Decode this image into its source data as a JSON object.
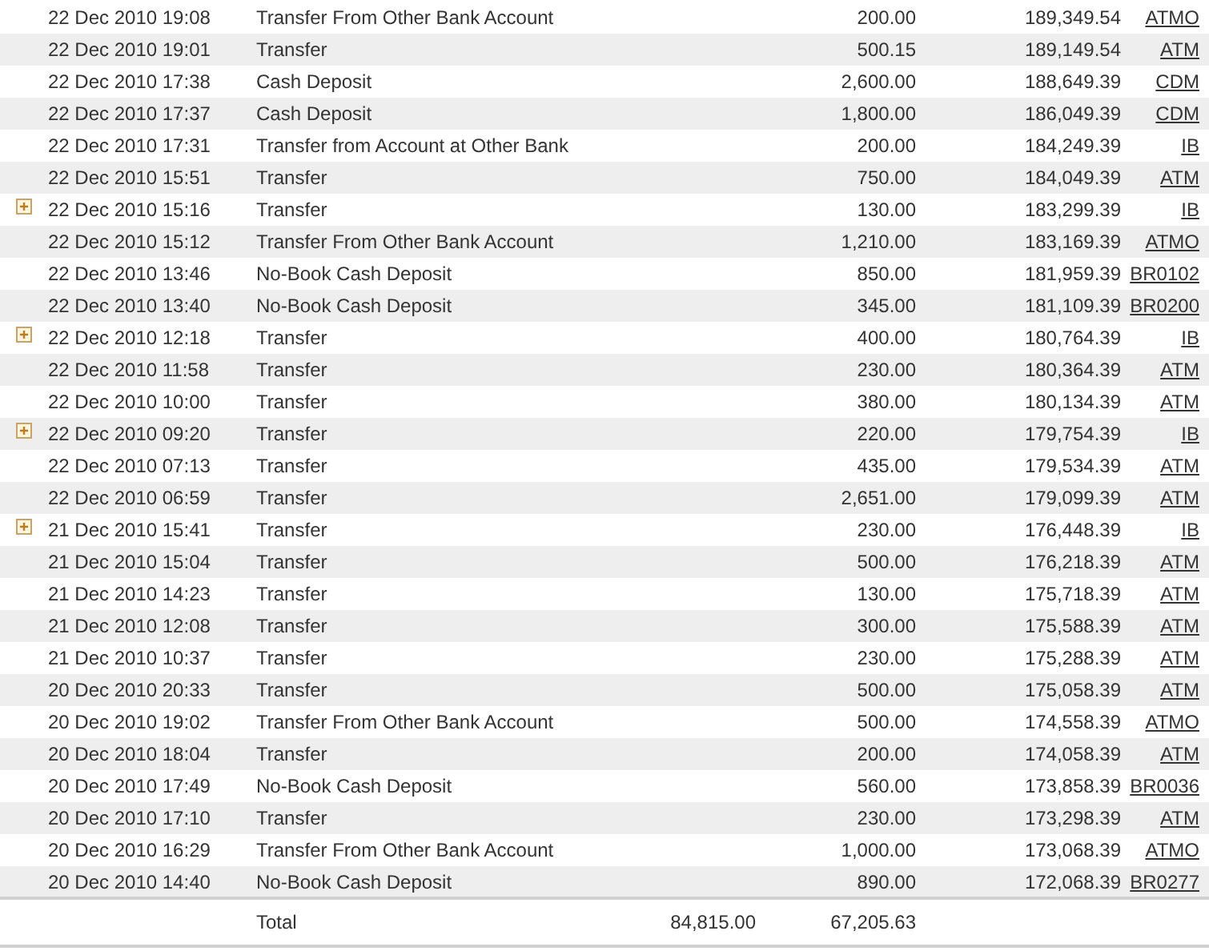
{
  "rows": [
    {
      "expandable": false,
      "date": "22 Dec 2010 19:08",
      "description": "Transfer From Other Bank Account",
      "amount": "200.00",
      "balance": "189,349.54",
      "ref": "ATMO"
    },
    {
      "expandable": false,
      "date": "22 Dec 2010 19:01",
      "description": "Transfer",
      "amount": "500.15",
      "balance": "189,149.54",
      "ref": "ATM"
    },
    {
      "expandable": false,
      "date": "22 Dec 2010 17:38",
      "description": "Cash Deposit",
      "amount": "2,600.00",
      "balance": "188,649.39",
      "ref": "CDM"
    },
    {
      "expandable": false,
      "date": "22 Dec 2010 17:37",
      "description": "Cash Deposit",
      "amount": "1,800.00",
      "balance": "186,049.39",
      "ref": "CDM"
    },
    {
      "expandable": false,
      "date": "22 Dec 2010 17:31",
      "description": "Transfer from Account at Other Bank",
      "amount": "200.00",
      "balance": "184,249.39",
      "ref": "IB"
    },
    {
      "expandable": false,
      "date": "22 Dec 2010 15:51",
      "description": "Transfer",
      "amount": "750.00",
      "balance": "184,049.39",
      "ref": "ATM"
    },
    {
      "expandable": true,
      "date": "22 Dec 2010 15:16",
      "description": "Transfer",
      "amount": "130.00",
      "balance": "183,299.39",
      "ref": "IB"
    },
    {
      "expandable": false,
      "date": "22 Dec 2010 15:12",
      "description": "Transfer From Other Bank Account",
      "amount": "1,210.00",
      "balance": "183,169.39",
      "ref": "ATMO"
    },
    {
      "expandable": false,
      "date": "22 Dec 2010 13:46",
      "description": "No-Book Cash Deposit",
      "amount": "850.00",
      "balance": "181,959.39",
      "ref": "BR0102"
    },
    {
      "expandable": false,
      "date": "22 Dec 2010 13:40",
      "description": "No-Book Cash Deposit",
      "amount": "345.00",
      "balance": "181,109.39",
      "ref": "BR0200"
    },
    {
      "expandable": true,
      "date": "22 Dec 2010 12:18",
      "description": "Transfer",
      "amount": "400.00",
      "balance": "180,764.39",
      "ref": "IB"
    },
    {
      "expandable": false,
      "date": "22 Dec 2010 11:58",
      "description": "Transfer",
      "amount": "230.00",
      "balance": "180,364.39",
      "ref": "ATM"
    },
    {
      "expandable": false,
      "date": "22 Dec 2010 10:00",
      "description": "Transfer",
      "amount": "380.00",
      "balance": "180,134.39",
      "ref": "ATM"
    },
    {
      "expandable": true,
      "date": "22 Dec 2010 09:20",
      "description": "Transfer",
      "amount": "220.00",
      "balance": "179,754.39",
      "ref": "IB"
    },
    {
      "expandable": false,
      "date": "22 Dec 2010 07:13",
      "description": "Transfer",
      "amount": "435.00",
      "balance": "179,534.39",
      "ref": "ATM"
    },
    {
      "expandable": false,
      "date": "22 Dec 2010 06:59",
      "description": "Transfer",
      "amount": "2,651.00",
      "balance": "179,099.39",
      "ref": "ATM"
    },
    {
      "expandable": true,
      "date": "21 Dec 2010 15:41",
      "description": "Transfer",
      "amount": "230.00",
      "balance": "176,448.39",
      "ref": "IB"
    },
    {
      "expandable": false,
      "date": "21 Dec 2010 15:04",
      "description": "Transfer",
      "amount": "500.00",
      "balance": "176,218.39",
      "ref": "ATM"
    },
    {
      "expandable": false,
      "date": "21 Dec 2010 14:23",
      "description": "Transfer",
      "amount": "130.00",
      "balance": "175,718.39",
      "ref": "ATM"
    },
    {
      "expandable": false,
      "date": "21 Dec 2010 12:08",
      "description": "Transfer",
      "amount": "300.00",
      "balance": "175,588.39",
      "ref": "ATM"
    },
    {
      "expandable": false,
      "date": "21 Dec 2010 10:37",
      "description": "Transfer",
      "amount": "230.00",
      "balance": "175,288.39",
      "ref": "ATM"
    },
    {
      "expandable": false,
      "date": "20 Dec 2010 20:33",
      "description": "Transfer",
      "amount": "500.00",
      "balance": "175,058.39",
      "ref": "ATM"
    },
    {
      "expandable": false,
      "date": "20 Dec 2010 19:02",
      "description": "Transfer From Other Bank Account",
      "amount": "500.00",
      "balance": "174,558.39",
      "ref": "ATMO"
    },
    {
      "expandable": false,
      "date": "20 Dec 2010 18:04",
      "description": "Transfer",
      "amount": "200.00",
      "balance": "174,058.39",
      "ref": "ATM"
    },
    {
      "expandable": false,
      "date": "20 Dec 2010 17:49",
      "description": "No-Book Cash Deposit",
      "amount": "560.00",
      "balance": "173,858.39",
      "ref": "BR0036"
    },
    {
      "expandable": false,
      "date": "20 Dec 2010 17:10",
      "description": "Transfer",
      "amount": "230.00",
      "balance": "173,298.39",
      "ref": "ATM"
    },
    {
      "expandable": false,
      "date": "20 Dec 2010 16:29",
      "description": "Transfer From Other Bank Account",
      "amount": "1,000.00",
      "balance": "173,068.39",
      "ref": "ATMO"
    },
    {
      "expandable": false,
      "date": "20 Dec 2010 14:40",
      "description": "No-Book Cash Deposit",
      "amount": "890.00",
      "balance": "172,068.39",
      "ref": "BR0277"
    }
  ],
  "total": {
    "label": "Total",
    "debit": "84,815.00",
    "credit": "67,205.63"
  }
}
